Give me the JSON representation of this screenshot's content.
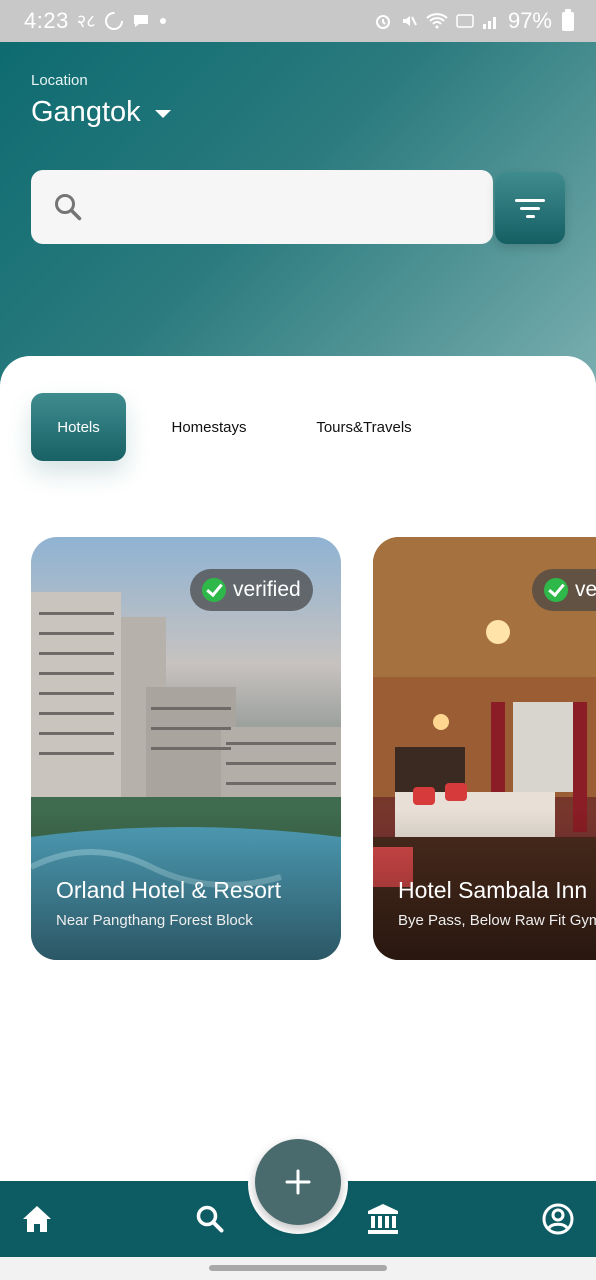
{
  "status_bar": {
    "time": "4:23",
    "carrier_glyph": "२८",
    "battery": "97%",
    "icons": [
      "loading-ring-icon",
      "chat-bubble-icon",
      "alarm-icon",
      "mute-icon",
      "wifi-icon",
      "volte-icon",
      "signal-icon",
      "battery-icon"
    ]
  },
  "header": {
    "location_caption": "Location",
    "location_value": "Gangtok",
    "search_placeholder": "",
    "colors": {
      "gradient_start": "#0d6b70",
      "gradient_end": "#7db0b1"
    }
  },
  "tabs": [
    {
      "label": "Hotels",
      "active": true
    },
    {
      "label": "Homestays",
      "active": false
    },
    {
      "label": "Tours&Travels",
      "active": false
    }
  ],
  "listings": [
    {
      "title": "Orland Hotel & Resort",
      "subtitle": "Near Pangthang Forest Block",
      "badge": "verified"
    },
    {
      "title": "Hotel Sambala Inn",
      "subtitle": "Bye Pass, Below Raw Fit Gym",
      "badge": "verified"
    }
  ],
  "bottom_nav": {
    "items": [
      "home-icon",
      "search-icon",
      "institution-icon",
      "account-icon"
    ],
    "fab_icon": "plus-icon",
    "colors": {
      "bar": "#0d5c63",
      "fab": "#4a6b6d"
    }
  }
}
